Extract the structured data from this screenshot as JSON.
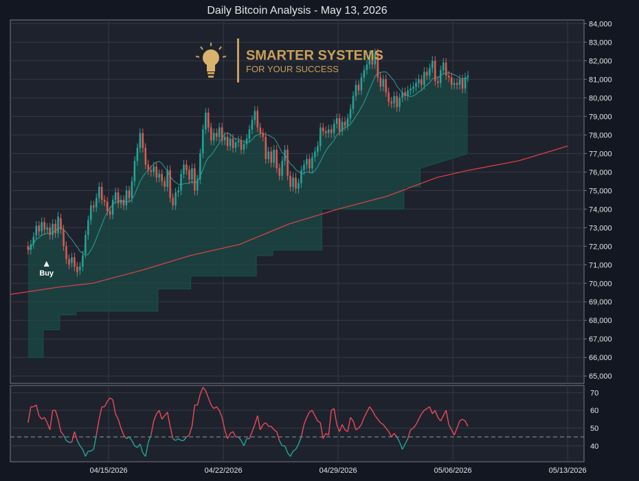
{
  "chart_data": {
    "type": "candlestick",
    "title": "Daily Bitcoin Analysis - May 13, 2026",
    "logo": {
      "line1": "SMARTER SYSTEMS",
      "line2": "FOR YOUR SUCCESS",
      "icon": "lightbulb-icon"
    },
    "x_tick_labels": [
      "04/15/2026",
      "04/22/2026",
      "04/29/2026",
      "05/06/2026",
      "05/13/2026"
    ],
    "x_tick_dates": [
      "2026-04-15",
      "2026-04-22",
      "2026-04-29",
      "2026-05-06",
      "2026-05-13"
    ],
    "x_range": [
      "2026-04-09",
      "2026-05-14"
    ],
    "price_axis": {
      "ylim": [
        64600,
        84200
      ],
      "ticks": [
        65000,
        66000,
        67000,
        68000,
        69000,
        70000,
        71000,
        72000,
        73000,
        74000,
        75000,
        76000,
        77000,
        78000,
        79000,
        80000,
        81000,
        82000,
        83000,
        84000
      ]
    },
    "rsi_axis": {
      "ylim": [
        31,
        74
      ],
      "ticks": [
        40,
        50,
        60,
        70
      ],
      "reference_level": 45
    },
    "colors": {
      "up": "#26a69a",
      "down": "#ef5350",
      "fill": "#1b4a45",
      "ma_long": "#e8404a",
      "ma_short": "#26a69a",
      "rsi_up": "#ef4a5a",
      "rsi_down": "#26a69a",
      "grid": "#363a45",
      "text": "#e6e6e6"
    },
    "annotations": [
      {
        "label": "Buy",
        "date": "2026-04-11",
        "price": 71200
      }
    ],
    "price_candles": {
      "start": "2026-04-10",
      "interval_hours": 4,
      "close": [
        71800,
        72100,
        72500,
        73100,
        72800,
        73300,
        72900,
        73000,
        72600,
        73200,
        72700,
        73600,
        72900,
        72000,
        71300,
        71000,
        71400,
        70900,
        70600,
        70900,
        71500,
        72600,
        73400,
        74200,
        74100,
        74600,
        75200,
        74500,
        74400,
        73900,
        73700,
        74500,
        74900,
        74300,
        74500,
        74200,
        75000,
        74600,
        75500,
        76600,
        77300,
        78100,
        77300,
        76400,
        76100,
        76000,
        76300,
        75700,
        75900,
        75500,
        75200,
        76100,
        74600,
        74200,
        74900,
        75000,
        75900,
        76400,
        76100,
        75600,
        76200,
        75000,
        75600,
        77000,
        78300,
        79200,
        78400,
        77700,
        78100,
        77900,
        78400,
        77700,
        77900,
        77400,
        77800,
        77300,
        77600,
        77700,
        77200,
        77500,
        77800,
        78300,
        78800,
        79300,
        78400,
        78100,
        77900,
        76700,
        77100,
        76500,
        77200,
        76200,
        75800,
        76600,
        77200,
        75800,
        75200,
        75700,
        75100,
        75400,
        76100,
        76400,
        76700,
        76200,
        76800,
        77100,
        77400,
        78400,
        78200,
        78100,
        78300,
        78100,
        78600,
        78900,
        78200,
        78700,
        78500,
        78900,
        79400,
        80100,
        80700,
        80400,
        81100,
        81500,
        81800,
        82300,
        81800,
        82400,
        81100,
        80600,
        81000,
        80300,
        79800,
        79700,
        80100,
        79500,
        80000,
        80300,
        80100,
        80400,
        80500,
        80600,
        80800,
        81000,
        80700,
        81400,
        81200,
        81600,
        82000,
        80900,
        80800,
        81500,
        81900,
        81200,
        81100,
        80700,
        80800,
        80700,
        81000,
        80500,
        81100,
        81200
      ],
      "open": [
        72000,
        71800,
        72100,
        72600,
        73100,
        72800,
        73300,
        72900,
        73000,
        72600,
        73200,
        72700,
        73500,
        72900,
        72000,
        71300,
        71100,
        71400,
        70900,
        70700,
        70900,
        71600,
        72600,
        73400,
        74200,
        74100,
        74600,
        75200,
        74500,
        74400,
        73900,
        73700,
        74500,
        74900,
        74300,
        74500,
        74200,
        75000,
        74600,
        75500,
        76600,
        77300,
        78100,
        77300,
        76400,
        76100,
        76000,
        76300,
        75700,
        75900,
        75500,
        75200,
        76100,
        74600,
        74200,
        74900,
        75000,
        75900,
        76400,
        76100,
        75600,
        76200,
        75000,
        75600,
        77000,
        78300,
        79200,
        78400,
        77700,
        78100,
        77900,
        78400,
        77700,
        77900,
        77400,
        77800,
        77300,
        77600,
        77700,
        77200,
        77500,
        77800,
        78300,
        78800,
        79300,
        78400,
        78100,
        77900,
        76700,
        77100,
        76500,
        77200,
        76200,
        75800,
        76600,
        77200,
        75800,
        75200,
        75700,
        75100,
        75400,
        76100,
        76400,
        76700,
        76200,
        76800,
        77100,
        77400,
        78400,
        78200,
        78100,
        78300,
        78100,
        78600,
        78900,
        78200,
        78700,
        78500,
        78900,
        79400,
        80100,
        80700,
        80400,
        81100,
        81500,
        81800,
        82300,
        81800,
        82400,
        81100,
        80600,
        81000,
        80300,
        79800,
        79700,
        80100,
        79500,
        80000,
        80300,
        80100,
        80400,
        80500,
        80600,
        80800,
        81000,
        80700,
        81400,
        81200,
        81600,
        82000,
        80900,
        80800,
        81500,
        81900,
        81200,
        81100,
        80700,
        80800,
        80700,
        81000,
        80500,
        81100
      ]
    },
    "trailing_band_steps": [
      {
        "from": "2026-04-10",
        "to": "2026-04-11",
        "value": 66000
      },
      {
        "from": "2026-04-11",
        "to": "2026-04-12",
        "value": 67500
      },
      {
        "from": "2026-04-12",
        "to": "2026-04-13",
        "value": 68300
      },
      {
        "from": "2026-04-13",
        "to": "2026-04-18",
        "value": 68500
      },
      {
        "from": "2026-04-18",
        "to": "2026-04-20",
        "value": 69700
      },
      {
        "from": "2026-04-20",
        "to": "2026-04-24",
        "value": 70400
      },
      {
        "from": "2026-04-24",
        "to": "2026-04-25",
        "value": 71500
      },
      {
        "from": "2026-04-25",
        "to": "2026-04-28",
        "value": 71800
      },
      {
        "from": "2026-04-28",
        "to": "2026-05-03",
        "value": 74000
      },
      {
        "from": "2026-05-03",
        "to": "2026-05-04",
        "value": 75200
      },
      {
        "from": "2026-05-04",
        "to": "2026-05-11",
        "value": 76200
      },
      {
        "from": "2026-05-11",
        "to": "2026-05-12",
        "value": 76700
      },
      {
        "from": "2026-05-12",
        "to": "2026-05-13",
        "value": 77000
      }
    ],
    "long_ma": [
      {
        "date": "2026-04-09",
        "value": 69400
      },
      {
        "date": "2026-04-12",
        "value": 69800
      },
      {
        "date": "2026-04-14",
        "value": 70000
      },
      {
        "date": "2026-04-17",
        "value": 70700
      },
      {
        "date": "2026-04-20",
        "value": 71500
      },
      {
        "date": "2026-04-23",
        "value": 72100
      },
      {
        "date": "2026-04-26",
        "value": 73200
      },
      {
        "date": "2026-04-29",
        "value": 74000
      },
      {
        "date": "2026-05-02",
        "value": 74700
      },
      {
        "date": "2026-05-05",
        "value": 75700
      },
      {
        "date": "2026-05-07",
        "value": 76100
      },
      {
        "date": "2026-05-10",
        "value": 76600
      },
      {
        "date": "2026-05-13",
        "value": 77400
      }
    ],
    "rsi": {
      "start": "2026-04-10",
      "interval_hours": 4,
      "values": [
        53,
        62,
        62,
        63,
        57,
        55,
        56,
        53,
        49,
        60,
        60,
        55,
        48,
        46,
        43,
        42,
        42,
        48,
        43,
        40,
        38,
        34,
        37,
        37,
        38,
        46,
        55,
        62,
        62,
        65,
        67,
        66,
        58,
        55,
        50,
        46,
        44,
        45,
        43,
        40,
        39,
        41,
        36,
        34,
        42,
        46,
        54,
        58,
        60,
        55,
        57,
        59,
        51,
        44,
        43,
        44,
        43,
        43,
        45,
        46,
        51,
        63,
        63,
        69,
        73,
        71,
        67,
        63,
        61,
        62,
        60,
        56,
        49,
        44,
        47,
        48,
        45,
        45,
        43,
        40,
        44,
        44,
        48,
        52,
        57,
        49,
        52,
        53,
        51,
        51,
        49,
        48,
        43,
        40,
        40,
        36,
        34,
        37,
        38,
        41,
        45,
        52,
        56,
        59,
        60,
        57,
        54,
        53,
        44,
        47,
        46,
        60,
        61,
        52,
        48,
        52,
        49,
        48,
        56,
        54,
        49,
        50,
        52,
        56,
        59,
        62,
        60,
        57,
        55,
        53,
        52,
        50,
        48,
        45,
        47,
        45,
        42,
        38,
        41,
        44,
        49,
        50,
        52,
        55,
        58,
        60,
        61,
        62,
        58,
        60,
        56,
        54,
        57,
        60,
        52,
        49,
        46,
        50,
        54,
        55,
        54,
        51
      ]
    }
  }
}
